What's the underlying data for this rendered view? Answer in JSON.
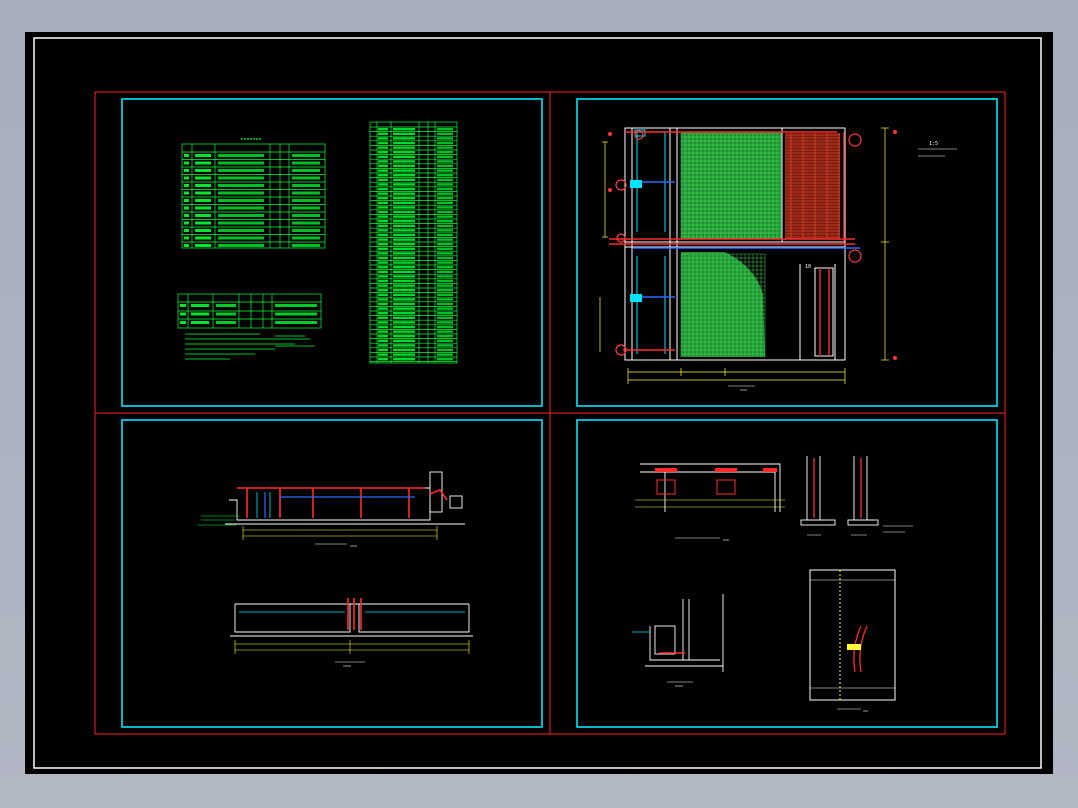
{
  "colors": {
    "background": "#000000",
    "outer_frame": "#ffffff",
    "sheet_border": "#ff2020",
    "panel_border": "#00e5ff",
    "table_lines": "#00ff33",
    "wall_lines": "#ffffff",
    "pipe": "#ff2a2a",
    "pipe_blue": "#2a6bff",
    "dimension": "#ffff33",
    "grid_fill": "#29c940",
    "hatch_red": "#d23a1e",
    "viewport_bg": "#a9afbd"
  },
  "icons": {
    "valve": "circle-valve-icon",
    "pump": "pump-icon",
    "section-mark": "section-mark-icon"
  },
  "labels": {
    "plan_dim": "1:5",
    "dim_10": "10"
  }
}
